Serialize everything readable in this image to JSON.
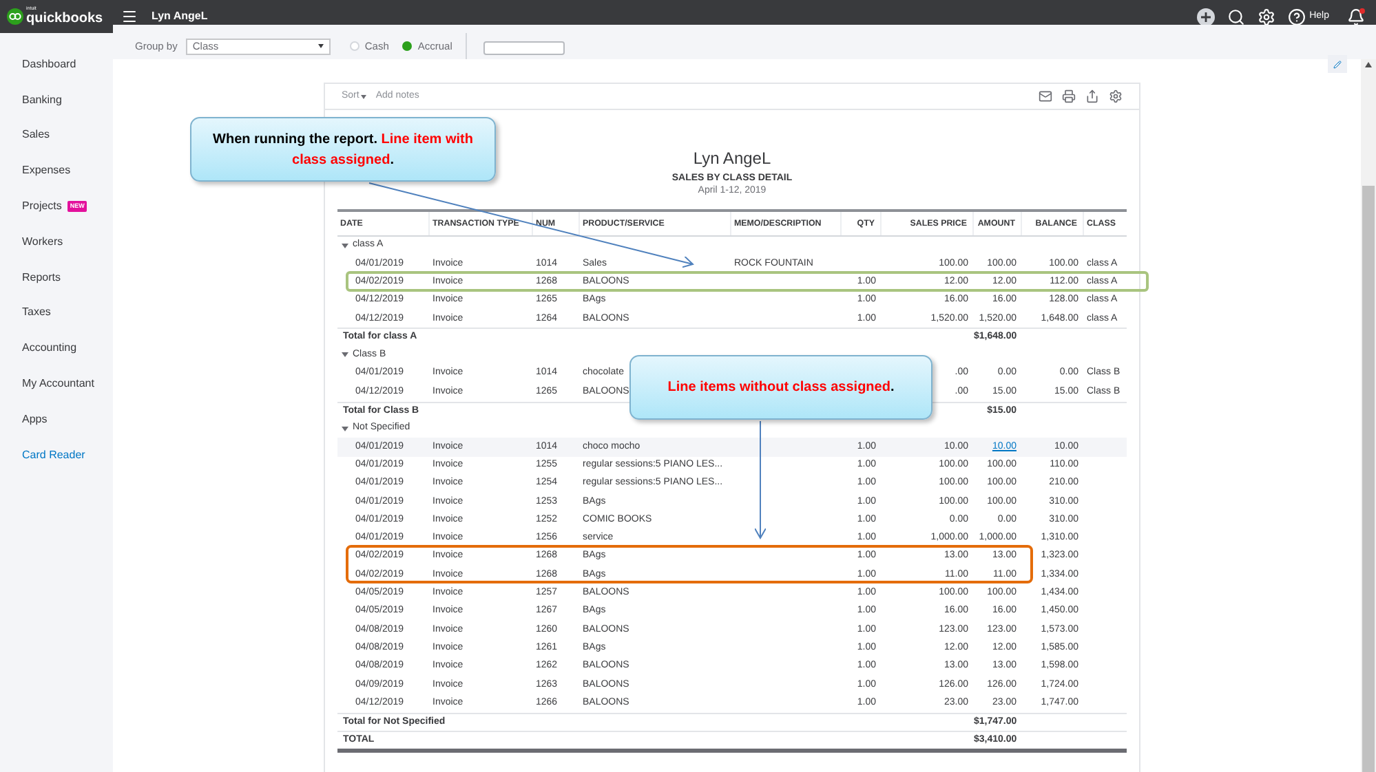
{
  "app": {
    "brand_small": "intuit",
    "brand": "quickbooks",
    "company": "Lyn AngeL",
    "help": "Help"
  },
  "filters": {
    "group_by_label": "Group by",
    "group_by_value": "Class",
    "methods": [
      {
        "label": "Cash",
        "selected": false
      },
      {
        "label": "Accrual",
        "selected": true
      }
    ]
  },
  "sidebar": {
    "items": [
      {
        "label": "Dashboard",
        "kind": "nav"
      },
      {
        "label": "Banking",
        "kind": "nav"
      },
      {
        "label": "Sales",
        "kind": "nav"
      },
      {
        "label": "Expenses",
        "kind": "nav"
      },
      {
        "label": "Projects",
        "kind": "nav",
        "badge": "NEW"
      },
      {
        "label": "Workers",
        "kind": "nav"
      },
      {
        "label": "Reports",
        "kind": "nav"
      },
      {
        "label": "Taxes",
        "kind": "nav"
      },
      {
        "label": "Accounting",
        "kind": "nav"
      },
      {
        "label": "My Accountant",
        "kind": "nav"
      },
      {
        "label": "Apps",
        "kind": "nav"
      },
      {
        "label": "Card Reader",
        "kind": "link"
      }
    ]
  },
  "report": {
    "actions": [
      "Sort",
      "Add notes"
    ],
    "company": "Lyn AngeL",
    "title": "SALES BY CLASS DETAIL",
    "period": "April 1-12, 2019",
    "columns": [
      "DATE",
      "TRANSACTION TYPE",
      "NUM",
      "PRODUCT/SERVICE",
      "MEMO/DESCRIPTION",
      "QTY",
      "SALES PRICE",
      "AMOUNT",
      "BALANCE",
      "CLASS"
    ],
    "groups": [
      {
        "name": "class A",
        "expanded": true,
        "total_label": "Total for class A",
        "total": "$1,648.00",
        "rows": [
          {
            "date": "04/01/2019",
            "type": "Invoice",
            "num": "1014",
            "product": "Sales",
            "memo": "ROCK FOUNTAIN",
            "price": "100.00",
            "amount": "100.00",
            "balance": "100.00",
            "class": "class A",
            "highlighted": false
          },
          {
            "date": "04/02/2019",
            "type": "Invoice",
            "num": "1268",
            "product": "BALOONS",
            "qty": "1.00",
            "price": "12.00",
            "amount": "12.00",
            "balance": "112.00",
            "class": "class A",
            "highlighted": false
          },
          {
            "date": "04/12/2019",
            "type": "Invoice",
            "num": "1265",
            "product": "BAgs",
            "qty": "1.00",
            "price": "16.00",
            "amount": "16.00",
            "balance": "128.00",
            "class": "class A",
            "highlighted": false
          },
          {
            "date": "04/12/2019",
            "type": "Invoice",
            "num": "1264",
            "product": "BALOONS",
            "qty": "1.00",
            "price": "1,520.00",
            "amount": "1,520.00",
            "balance": "1,648.00",
            "class": "class A",
            "highlighted": false
          }
        ]
      },
      {
        "name": "Class B",
        "expanded": true,
        "total_label": "Total for Class B",
        "total": "$15.00",
        "rows": [
          {
            "date": "04/01/2019",
            "type": "Invoice",
            "num": "1014",
            "product": "chocolate",
            "price": ".00",
            "amount": "0.00",
            "balance": "0.00",
            "class": "Class B",
            "highlighted": false
          },
          {
            "date": "04/12/2019",
            "type": "Invoice",
            "num": "1265",
            "product": "BALOONS",
            "price": ".00",
            "amount": "15.00",
            "balance": "15.00",
            "class": "Class B",
            "highlighted": false
          }
        ]
      },
      {
        "name": "Not Specified",
        "expanded": true,
        "total_label": "Total for Not Specified",
        "total": "$1,747.00",
        "rows": [
          {
            "date": "04/01/2019",
            "type": "Invoice",
            "num": "1014",
            "product": "choco mocho",
            "qty": "1.00",
            "price": "10.00",
            "amount": "10.00",
            "balance": "10.00",
            "highlighted": true
          },
          {
            "date": "04/01/2019",
            "type": "Invoice",
            "num": "1255",
            "product": "regular sessions:5 PIANO LES...",
            "qty": "1.00",
            "price": "100.00",
            "amount": "100.00",
            "balance": "110.00",
            "highlighted": false
          },
          {
            "date": "04/01/2019",
            "type": "Invoice",
            "num": "1254",
            "product": "regular sessions:5 PIANO LES...",
            "qty": "1.00",
            "price": "100.00",
            "amount": "100.00",
            "balance": "210.00",
            "highlighted": false
          },
          {
            "date": "04/01/2019",
            "type": "Invoice",
            "num": "1253",
            "product": "BAgs",
            "qty": "1.00",
            "price": "100.00",
            "amount": "100.00",
            "balance": "310.00",
            "highlighted": false
          },
          {
            "date": "04/01/2019",
            "type": "Invoice",
            "num": "1252",
            "product": "COMIC BOOKS",
            "qty": "1.00",
            "price": "0.00",
            "amount": "0.00",
            "balance": "310.00",
            "highlighted": false
          },
          {
            "date": "04/01/2019",
            "type": "Invoice",
            "num": "1256",
            "product": "service",
            "qty": "1.00",
            "price": "1,000.00",
            "amount": "1,000.00",
            "balance": "1,310.00",
            "highlighted": false
          },
          {
            "date": "04/02/2019",
            "type": "Invoice",
            "num": "1268",
            "product": "BAgs",
            "qty": "1.00",
            "price": "13.00",
            "amount": "13.00",
            "balance": "1,323.00",
            "highlighted": false
          },
          {
            "date": "04/02/2019",
            "type": "Invoice",
            "num": "1268",
            "product": "BAgs",
            "qty": "1.00",
            "price": "11.00",
            "amount": "11.00",
            "balance": "1,334.00",
            "highlighted": false
          },
          {
            "date": "04/05/2019",
            "type": "Invoice",
            "num": "1257",
            "product": "BALOONS",
            "qty": "1.00",
            "price": "100.00",
            "amount": "100.00",
            "balance": "1,434.00",
            "highlighted": false
          },
          {
            "date": "04/05/2019",
            "type": "Invoice",
            "num": "1267",
            "product": "BAgs",
            "qty": "1.00",
            "price": "16.00",
            "amount": "16.00",
            "balance": "1,450.00",
            "highlighted": false
          },
          {
            "date": "04/08/2019",
            "type": "Invoice",
            "num": "1260",
            "product": "BALOONS",
            "qty": "1.00",
            "price": "123.00",
            "amount": "123.00",
            "balance": "1,573.00",
            "highlighted": false
          },
          {
            "date": "04/08/2019",
            "type": "Invoice",
            "num": "1261",
            "product": "BAgs",
            "qty": "1.00",
            "price": "12.00",
            "amount": "12.00",
            "balance": "1,585.00",
            "highlighted": false
          },
          {
            "date": "04/08/2019",
            "type": "Invoice",
            "num": "1262",
            "product": "BALOONS",
            "qty": "1.00",
            "price": "13.00",
            "amount": "13.00",
            "balance": "1,598.00",
            "highlighted": false
          },
          {
            "date": "04/09/2019",
            "type": "Invoice",
            "num": "1263",
            "product": "BALOONS",
            "qty": "1.00",
            "price": "126.00",
            "amount": "126.00",
            "balance": "1,724.00",
            "highlighted": false
          },
          {
            "date": "04/12/2019",
            "type": "Invoice",
            "num": "1266",
            "product": "BALOONS",
            "qty": "1.00",
            "price": "23.00",
            "amount": "23.00",
            "balance": "1,747.00",
            "highlighted": false
          }
        ]
      }
    ],
    "grand_total_label": "TOTAL",
    "grand_total": "$3,410.00"
  },
  "annotations": {
    "callouts": [
      {
        "parts": [
          {
            "text": "When running the report. ",
            "emphasis": false
          },
          {
            "text": "Line item with class assigned",
            "emphasis": true
          },
          {
            "text": ".",
            "emphasis": false
          }
        ]
      },
      {
        "parts": [
          {
            "text": "Line items without class assigned",
            "emphasis": true
          },
          {
            "text": ".",
            "emphasis": false
          }
        ]
      }
    ],
    "outlines": [
      {
        "color": "#a9c47f"
      },
      {
        "color": "#e46c0a"
      }
    ]
  }
}
